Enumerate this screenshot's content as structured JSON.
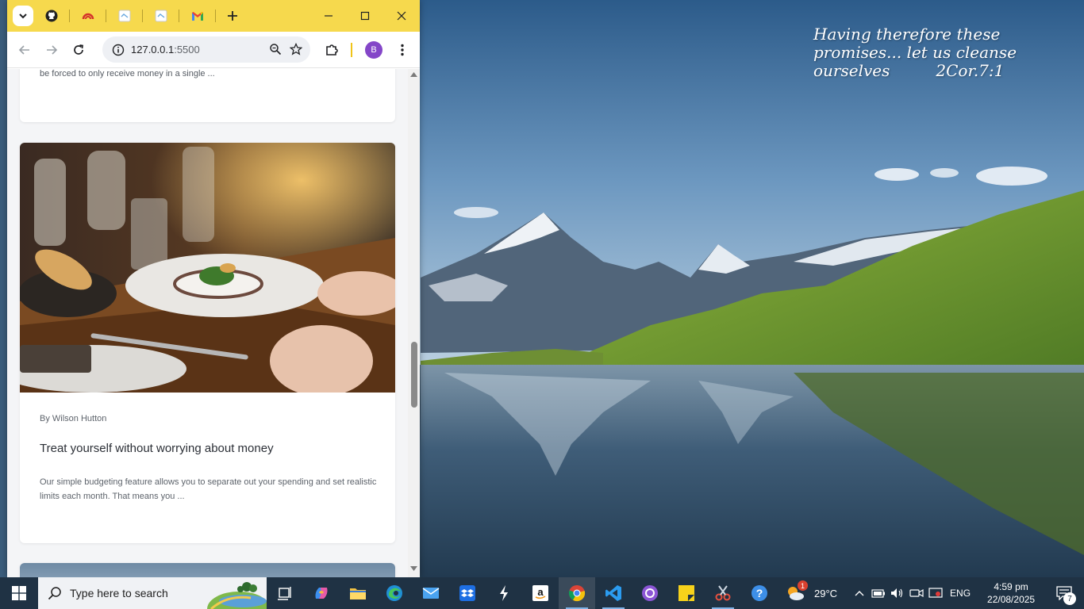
{
  "desktop": {
    "quote_line1": "Having therefore these",
    "quote_line2": "promises... let us cleanse",
    "quote_line3_text": "ourselves",
    "quote_reference": "2Cor.7:1"
  },
  "browser": {
    "tabs": [
      {
        "icon": "github-icon"
      },
      {
        "icon": "gauge-icon"
      },
      {
        "icon": "page-icon"
      },
      {
        "icon": "page-icon"
      },
      {
        "icon": "gmail-icon"
      }
    ],
    "new_tab_label": "+",
    "url_host": "127.0.0.1",
    "url_port": ":5500",
    "profile_initial": "B"
  },
  "page": {
    "previous_card_excerpt": "be forced to only receive money in a single ...",
    "article": {
      "author": "By Wilson Hutton",
      "title": "Treat yourself without worrying about money",
      "excerpt": "Our simple budgeting feature allows you to separate out your spending and set realistic limits each month. That means you ..."
    }
  },
  "taskbar": {
    "search_placeholder": "Type here to search",
    "pinned_apps": [
      "task-view",
      "copilot",
      "file-explorer",
      "edge",
      "mail",
      "dropbox",
      "app-s",
      "amazon",
      "chrome",
      "vscode",
      "github-desktop",
      "sticky-notes",
      "snipping-tool",
      "help"
    ],
    "temperature": "29°C",
    "weather_badge": "1",
    "language": "ENG",
    "time": "4:59 pm",
    "date": "22/08/2025",
    "notification_count": "7"
  },
  "colors": {
    "tabstrip": "#f6d94d",
    "taskbar": "#1f3244",
    "avatar": "#8446c8"
  }
}
